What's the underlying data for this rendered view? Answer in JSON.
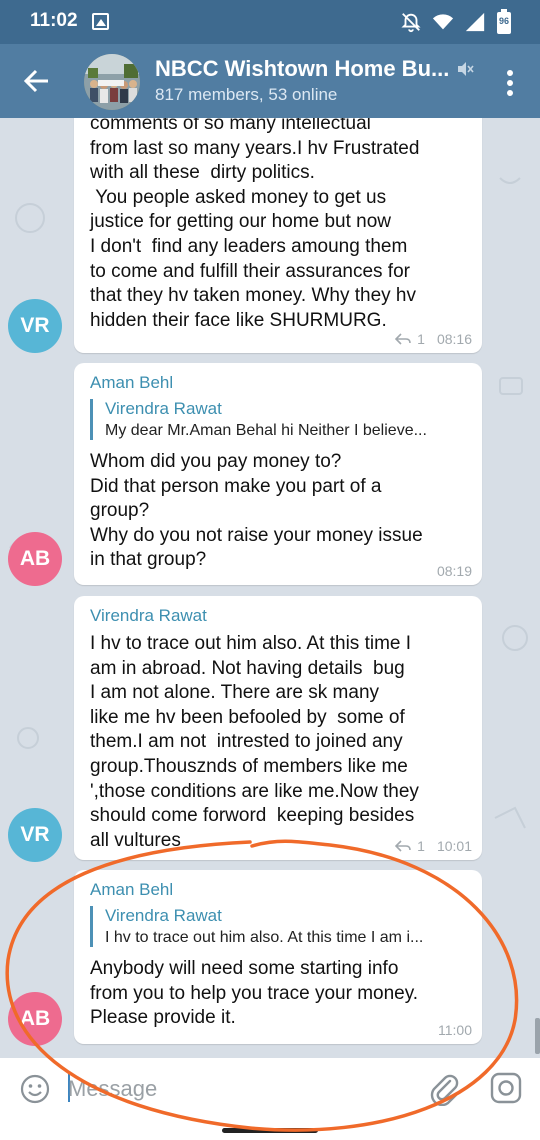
{
  "status_bar": {
    "time": "11:02",
    "battery": "96"
  },
  "header": {
    "title": "NBCC Wishtown Home Bu...",
    "subtitle": "817 members, 53 online"
  },
  "messages": [
    {
      "avatar_initials": "VR",
      "avatar_color": "#57b6d6",
      "text": "comments of so many intellectual\nfrom last so many years.I hv Frustrated\nwith all these  dirty politics.\n You people asked money to get us\njustice for getting our home but now\nI don't  find any leaders amoung them\nto come and fulfill their assurances for\nthat they hv taken money. Why they hv\nhidden their face like SHURMURG.",
      "reply_count": "1",
      "time": "08:16"
    },
    {
      "sender": "Aman Behl",
      "avatar_initials": "AB",
      "avatar_color": "#ee6b8f",
      "reply_to": {
        "name": "Virendra Rawat",
        "text": "My dear Mr.Aman Behal hi Neither I believe..."
      },
      "text": "Whom did you pay money to?\nDid that person make you part of a\ngroup?\nWhy do you not raise your money issue\nin that group?",
      "time": "08:19"
    },
    {
      "sender": "Virendra Rawat",
      "avatar_initials": "VR",
      "avatar_color": "#57b6d6",
      "text": "I hv to trace out him also. At this time I\nam in abroad. Not having details  bug\nI am not alone. There are sk many\nlike me hv been befooled by  some of\nthem.I am not  intrested to joined any\ngroup.Thousznds of members like me\n',those conditions are like me.Now they\nshould come forword  keeping besides\nall vultures",
      "reply_count": "1",
      "time": "10:01"
    },
    {
      "sender": "Aman Behl",
      "avatar_initials": "AB",
      "avatar_color": "#ee6b8f",
      "reply_to": {
        "name": "Virendra Rawat",
        "text": "I hv to trace out him also. At this time I am i..."
      },
      "text": "Anybody will need some starting info\nfrom you to help you trace your money.\nPlease provide it.",
      "time": "11:00"
    }
  ],
  "input": {
    "placeholder": "Message"
  },
  "colors": {
    "toolbar": "#517da2",
    "status_bar": "#3e6a8f",
    "annotation_circle": "#f06a2a"
  }
}
